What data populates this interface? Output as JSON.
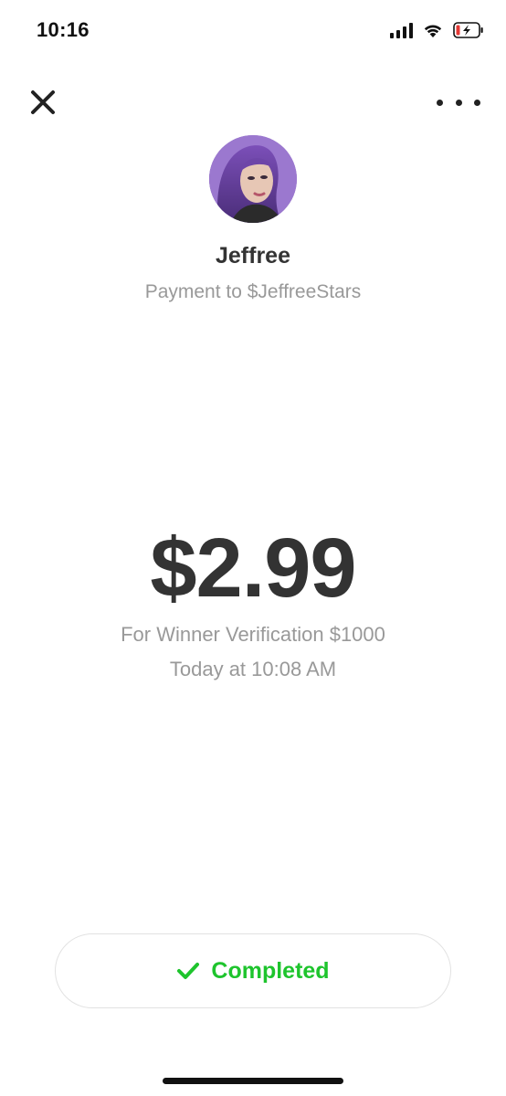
{
  "status_bar": {
    "time": "10:16",
    "icons": [
      "signal-icon",
      "wifi-icon",
      "battery-charging-icon"
    ],
    "battery_color": "#e53935"
  },
  "nav": {
    "close_icon": "close-icon",
    "more_icon": "more-icon"
  },
  "recipient": {
    "name": "Jeffree",
    "subtitle": "Payment to $JeffreeStars"
  },
  "payment": {
    "amount": "$2.99",
    "note": "For Winner Verification $1000",
    "timestamp": "Today at 10:08 AM"
  },
  "status": {
    "label": "Completed",
    "icon": "check-icon",
    "color": "#1ec42d"
  }
}
